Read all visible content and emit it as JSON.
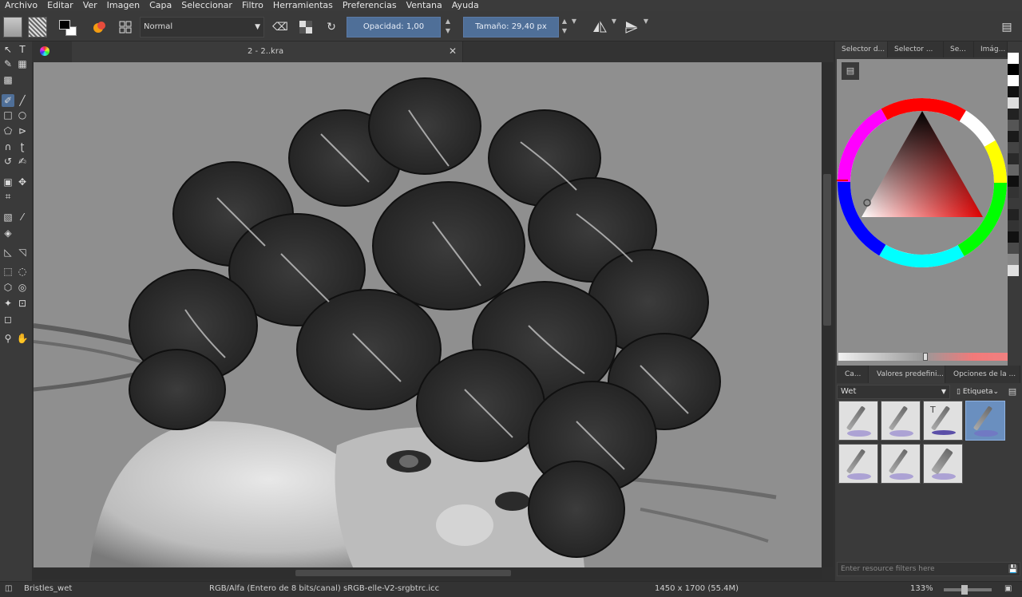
{
  "menu": [
    "Archivo",
    "Editar",
    "Ver",
    "Imagen",
    "Capa",
    "Seleccionar",
    "Filtro",
    "Herramientas",
    "Preferencias",
    "Ventana",
    "Ayuda"
  ],
  "toolbar": {
    "blend_mode": "Normal",
    "opacity_label": "Opacidad: 1,00",
    "size_label": "Tamaño: 29,40 px"
  },
  "document": {
    "title": "2 - 2..kra"
  },
  "right_panel": {
    "tabs": [
      "Selector d...",
      "Selector ...",
      "Se...",
      "Imág..."
    ],
    "preset_tabs": [
      "Ca...",
      "Valores predefini...",
      "Opciones de la ..."
    ],
    "preset_filter": "Wet",
    "tag_label": "Etiqueta",
    "resource_filter_placeholder": "Enter resource filters here"
  },
  "status": {
    "brush": "Bristles_wet",
    "color_info": "RGB/Alfa (Entero de 8 bits/canal)  sRGB-elle-V2-srgbtrc.icc",
    "dimensions": "1450 x 1700 (55.4M)",
    "zoom": "133%"
  },
  "colors": {
    "accent": "#4f6f98",
    "panel": "#3a3a3a",
    "canvas_bg": "#8e8e8e",
    "fg_color": "#000000",
    "bg_color": "#ffffff"
  },
  "icons": {
    "eraser": "eraser-icon",
    "preserve_alpha": "checker-icon",
    "reload": "reload-icon",
    "mirror_h": "mirror-horizontal-icon",
    "mirror_v": "mirror-vertical-icon",
    "dock": "dock-icon"
  }
}
